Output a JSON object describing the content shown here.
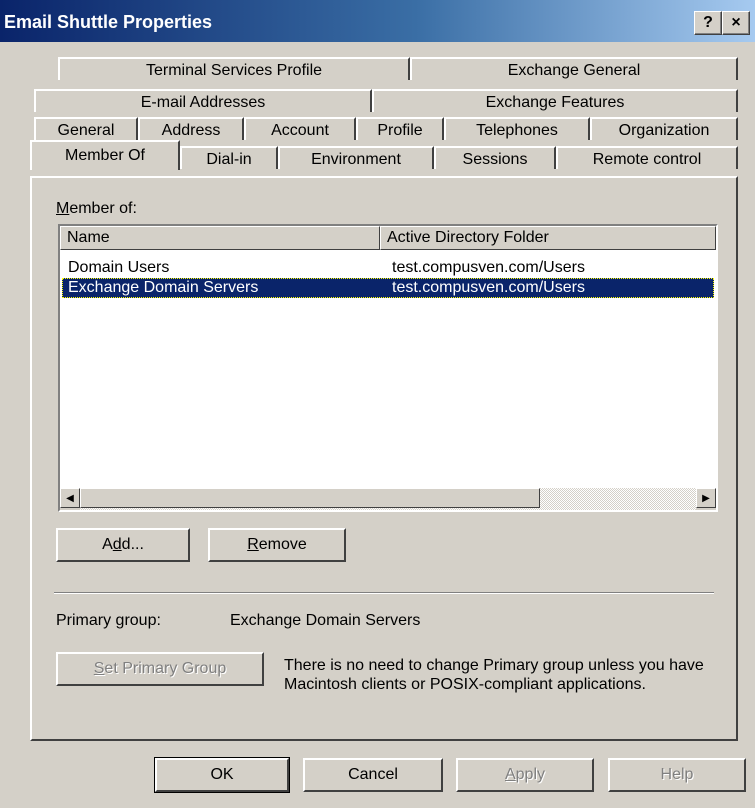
{
  "window": {
    "title": "Email Shuttle Properties",
    "help_glyph": "?",
    "close_glyph": "×"
  },
  "tabs": {
    "row1": [
      "Terminal Services Profile",
      "Exchange General"
    ],
    "row2": [
      "E-mail Addresses",
      "Exchange Features"
    ],
    "row3": [
      "General",
      "Address",
      "Account",
      "Profile",
      "Telephones",
      "Organization"
    ],
    "row4": [
      "Member Of",
      "Dial-in",
      "Environment",
      "Sessions",
      "Remote control"
    ],
    "active": "Member Of"
  },
  "member_of": {
    "label_prefix": "",
    "label_accel": "M",
    "label_rest": "ember of:",
    "columns": [
      "Name",
      "Active Directory Folder"
    ],
    "rows": [
      {
        "name": "Domain Users",
        "folder": "test.compusven.com/Users",
        "selected": false
      },
      {
        "name": "Exchange Domain Servers",
        "folder": "test.compusven.com/Users",
        "selected": true
      }
    ]
  },
  "buttons": {
    "add": {
      "prefix": "A",
      "accel": "d",
      "rest": "d..."
    },
    "remove": {
      "prefix": "",
      "accel": "R",
      "rest": "emove"
    }
  },
  "primary_group": {
    "label": "Primary group:",
    "value": "Exchange Domain Servers",
    "set_button": {
      "prefix": "",
      "accel": "S",
      "rest": "et Primary Group"
    },
    "note": "There is no need to change Primary group unless you have Macintosh clients or POSIX-compliant applications."
  },
  "footer": {
    "ok": "OK",
    "cancel": "Cancel",
    "apply": {
      "prefix": "",
      "accel": "A",
      "rest": "pply"
    },
    "help": "Help"
  },
  "colors": {
    "titlebar_start": "#0a246a",
    "titlebar_end": "#a6caf0",
    "face": "#d4d0c8",
    "selection": "#0a246a"
  }
}
